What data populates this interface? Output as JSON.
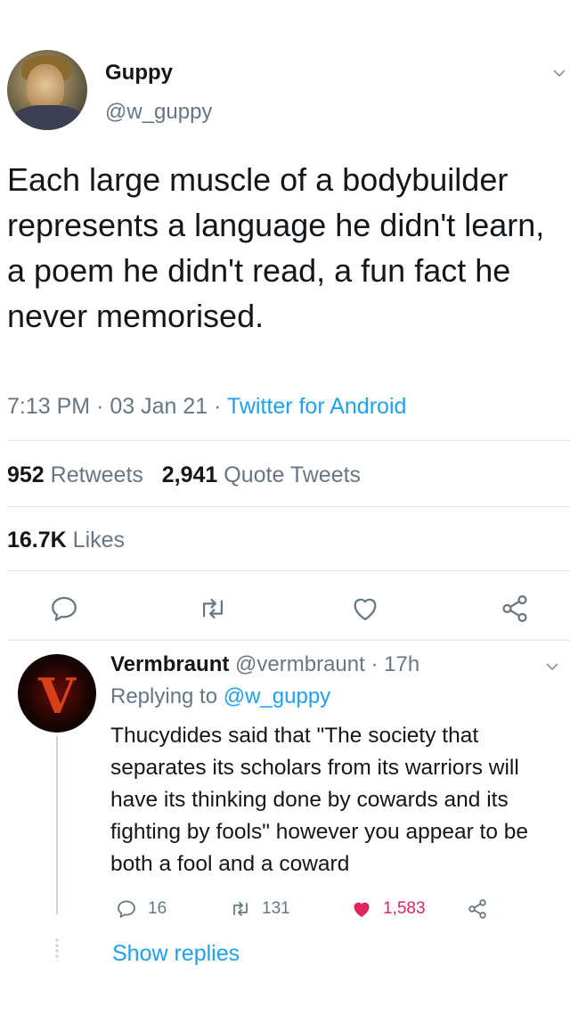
{
  "tweet": {
    "author_name": "Guppy",
    "author_handle": "@w_guppy",
    "text": "Each large muscle of a bodybuilder represents a language he didn't learn, a poem he didn't read, a fun fact he never memorised.",
    "time": "7:13 PM",
    "date": "03 Jan 21",
    "source": "Twitter for Android",
    "separator": " · ",
    "retweets_count": "952",
    "retweets_label": "Retweets",
    "quotes_count": "2,941",
    "quotes_label": "Quote Tweets",
    "likes_count": "16.7K",
    "likes_label": "Likes"
  },
  "reply": {
    "author_name": "Vermbraunt",
    "author_handle": "@vermbraunt",
    "age": "17h",
    "replying_prefix": "Replying to",
    "replying_to": "@w_guppy",
    "text": "Thucydides said that \"The society that separates its scholars from its warriors will have its thinking done by cowards and its fighting by fools\" however you appear to be both a fool and a coward",
    "reply_count": "16",
    "retweet_count": "131",
    "like_count": "1,583",
    "show_replies": "Show replies",
    "avatar_letter": "V"
  },
  "colors": {
    "text": "#14171a",
    "secondary": "#657786",
    "link": "#1da1f2",
    "like_red": "#e0245e",
    "divider": "#e1e8ed"
  },
  "icons": {
    "reply": "reply-icon",
    "retweet": "retweet-icon",
    "like": "heart-icon",
    "share": "share-icon",
    "menu": "chevron-down-icon"
  }
}
